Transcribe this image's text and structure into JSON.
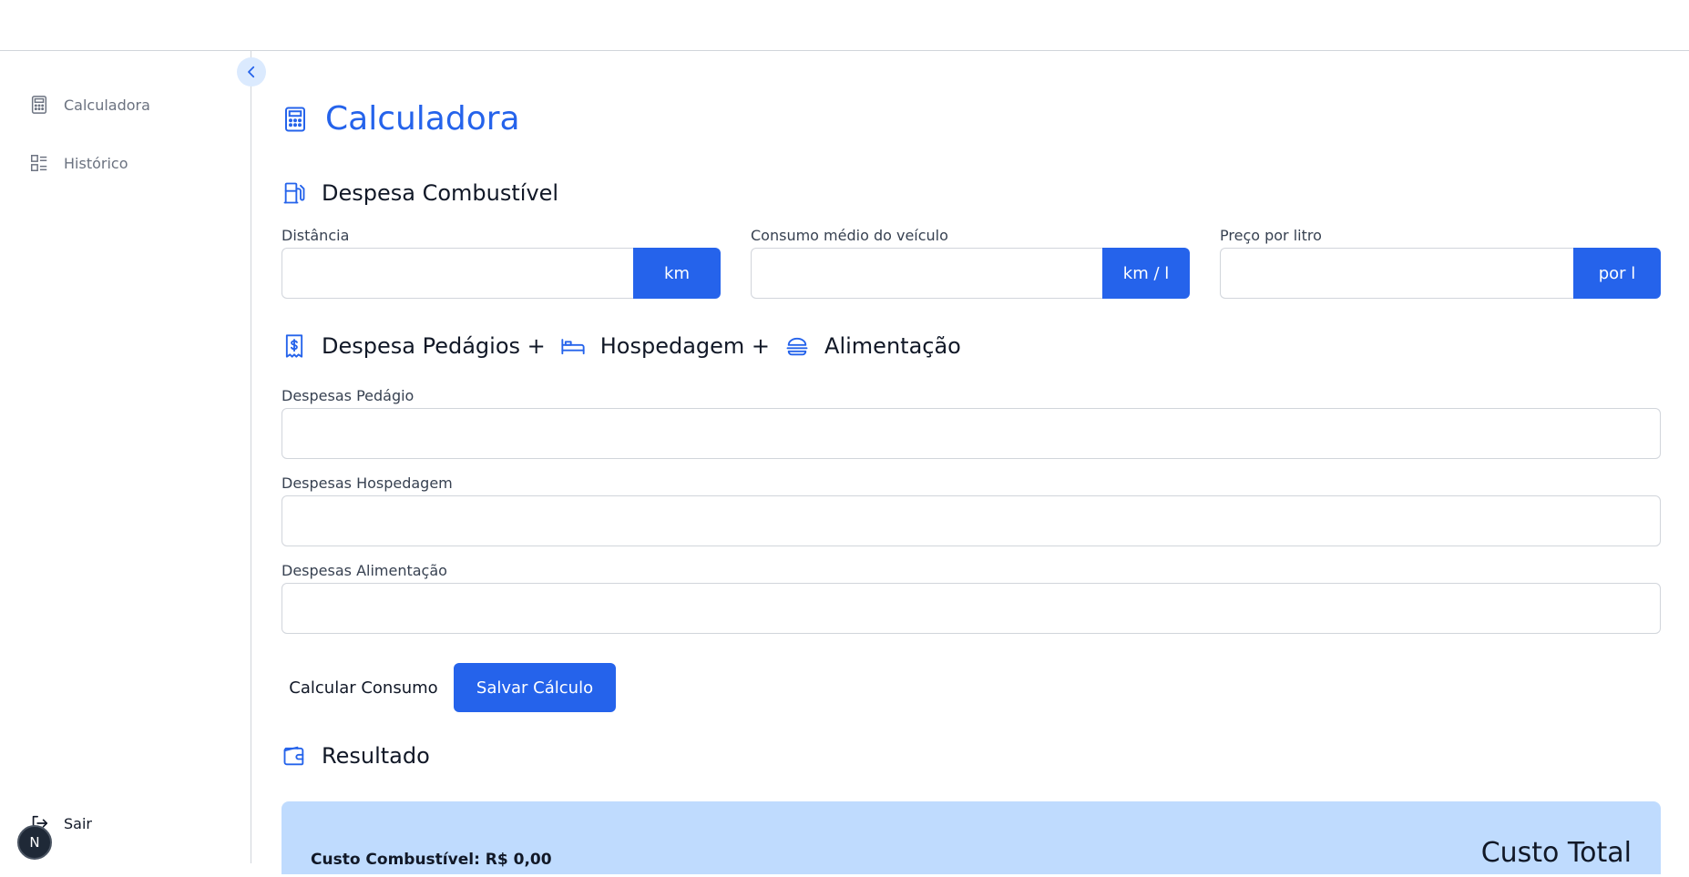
{
  "colors": {
    "accent": "#2563eb",
    "result_bg": "#bfdbfe",
    "border": "#d1d5db",
    "muted": "#6b7280"
  },
  "sidebar": {
    "items": [
      {
        "label": "Calculadora",
        "icon": "calculator-icon"
      },
      {
        "label": "Histórico",
        "icon": "list-icon"
      }
    ],
    "logout_label": "Sair",
    "avatar_initial": "N"
  },
  "page": {
    "title": "Calculadora"
  },
  "fuel": {
    "title": "Despesa Combustível",
    "fields": [
      {
        "label": "Distância",
        "unit": "km",
        "value": ""
      },
      {
        "label": "Consumo médio do veículo",
        "unit": "km / l",
        "value": ""
      },
      {
        "label": "Preço por litro",
        "unit": "por l",
        "value": ""
      }
    ]
  },
  "extras": {
    "title_part1": "Despesa Pedágios +",
    "title_part2": "Hospedagem +",
    "title_part3": "Alimentação",
    "fields": [
      {
        "label": "Despesas Pedágio",
        "value": ""
      },
      {
        "label": "Despesas Hospedagem",
        "value": ""
      },
      {
        "label": "Despesas Alimentação",
        "value": ""
      }
    ]
  },
  "actions": {
    "calculate_label": "Calcular Consumo",
    "save_label": "Salvar Cálculo"
  },
  "result": {
    "title": "Resultado",
    "fuel_cost": "Custo Combustível: R$ 0,00",
    "total_label": "Custo Total"
  }
}
